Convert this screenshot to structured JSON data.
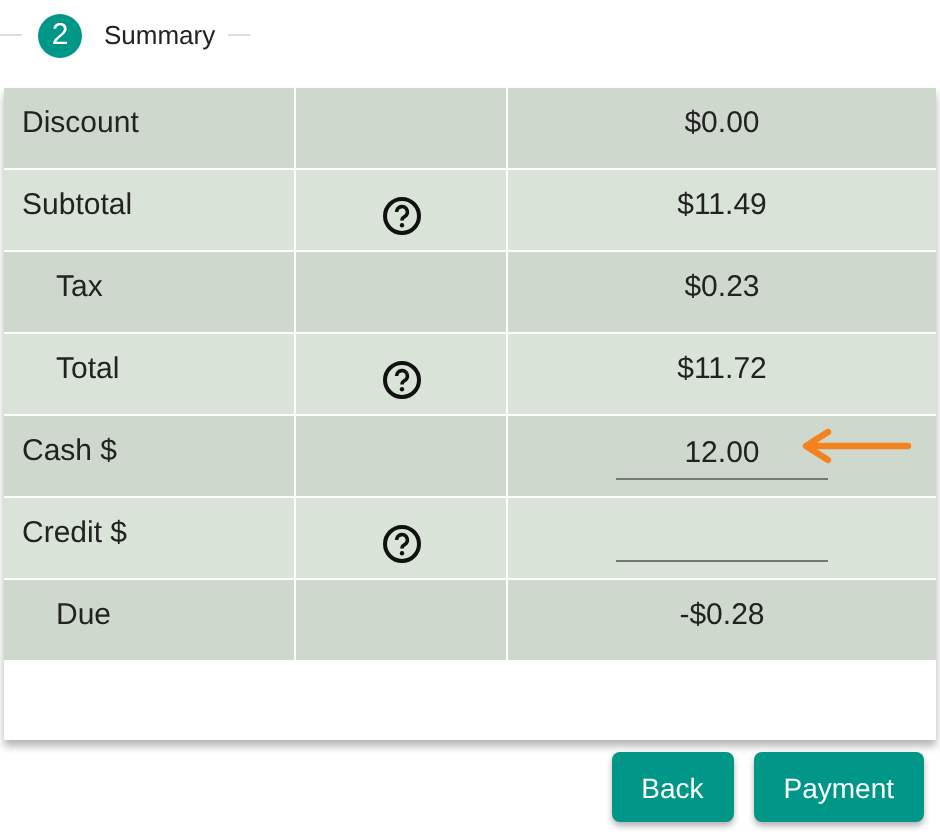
{
  "step": {
    "number": "2",
    "title": "Summary"
  },
  "rows": [
    {
      "kind": "value",
      "label": "Discount",
      "indented": false,
      "help": false,
      "value": "$0.00",
      "pointer": false
    },
    {
      "kind": "value",
      "label": "Subtotal",
      "indented": false,
      "help": true,
      "value": "$11.49",
      "pointer": false
    },
    {
      "kind": "value",
      "label": "Tax",
      "indented": true,
      "help": false,
      "value": "$0.23",
      "pointer": false
    },
    {
      "kind": "value",
      "label": "Total",
      "indented": true,
      "help": true,
      "value": "$11.72",
      "pointer": false
    },
    {
      "kind": "field",
      "label": "Cash $",
      "indented": false,
      "help": false,
      "value": "12.00",
      "pointer": true
    },
    {
      "kind": "field",
      "label": "Credit $",
      "indented": false,
      "help": true,
      "pointer": false
    },
    {
      "kind": "value",
      "label": "Due",
      "indented": true,
      "help": false,
      "value": "-$0.28",
      "pointer": false
    }
  ],
  "buttons": [
    {
      "label": "Back"
    },
    {
      "label": "Payment"
    }
  ]
}
